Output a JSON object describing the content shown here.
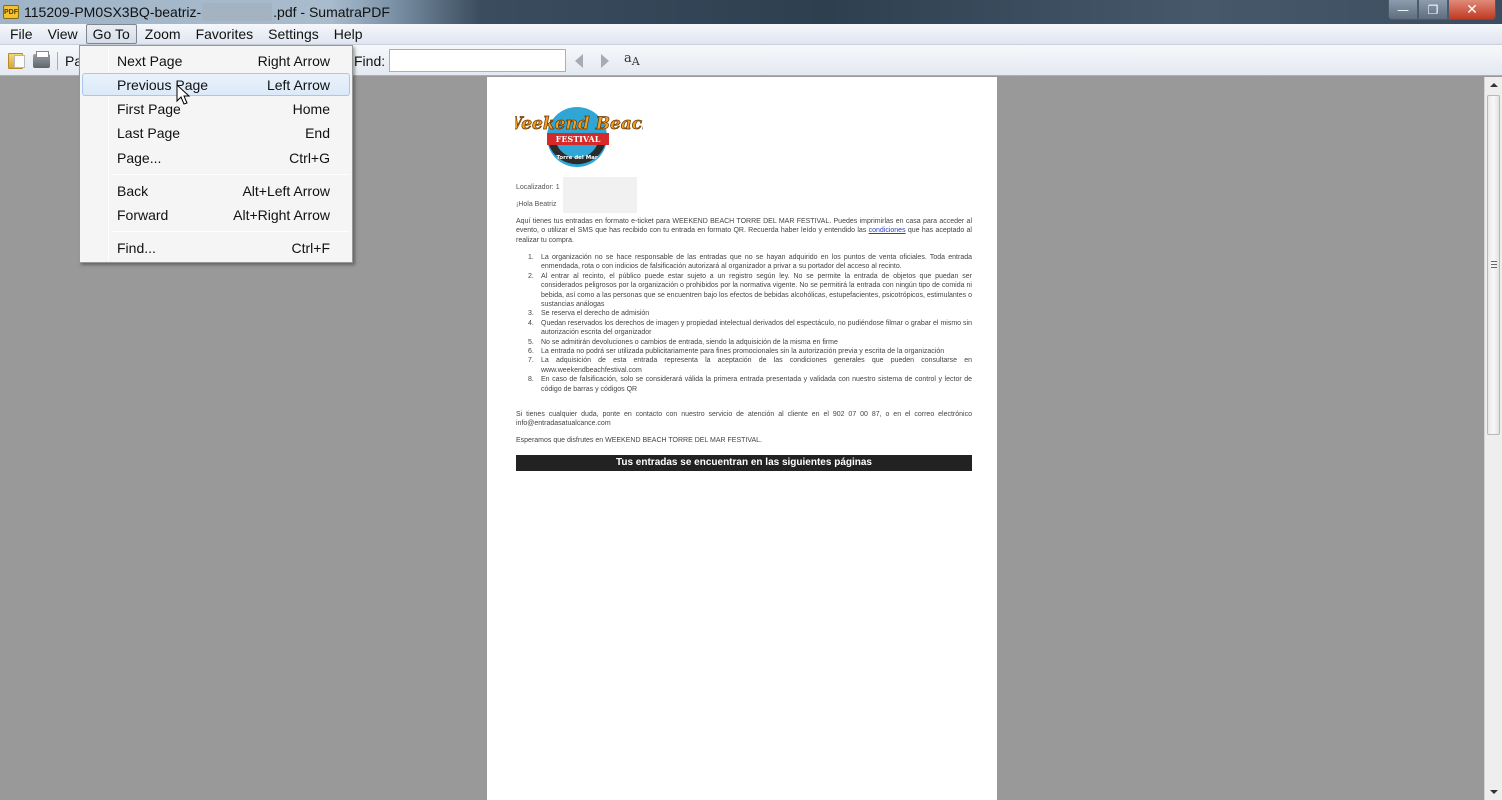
{
  "window": {
    "title_prefix": "115209-PM0SX3BQ-beatriz-",
    "title_suffix": ".pdf - SumatraPDF",
    "app_icon_label": "PDF",
    "controls": {
      "minimize": "—",
      "maximize": "❐",
      "close": "✕"
    }
  },
  "menubar": {
    "items": [
      "File",
      "View",
      "Go To",
      "Zoom",
      "Favorites",
      "Settings",
      "Help"
    ],
    "open_item": "Go To"
  },
  "toolbar": {
    "page_label_partial": "Pa",
    "find_label": "Find:",
    "find_value": "",
    "match_case_glyph_small": "a",
    "match_case_glyph_big": "A"
  },
  "goto_menu": {
    "items": [
      {
        "label": "Next Page",
        "shortcut": "Right Arrow"
      },
      {
        "label": "Previous Page",
        "shortcut": "Left Arrow",
        "hovered": true
      },
      {
        "label": "First Page",
        "shortcut": "Home"
      },
      {
        "label": "Last Page",
        "shortcut": "End"
      },
      {
        "label": "Page...",
        "shortcut": "Ctrl+G"
      },
      {
        "label": "Back",
        "shortcut": "Alt+Left Arrow"
      },
      {
        "label": "Forward",
        "shortcut": "Alt+Right Arrow"
      },
      {
        "label": "Find...",
        "shortcut": "Ctrl+F"
      }
    ]
  },
  "document": {
    "logo": {
      "line1": "Weekend Beach",
      "ribbon": "FESTIVAL",
      "arc": "Torre del Mar"
    },
    "localizador_label": "Localizador: 1",
    "greeting": "¡Hola Beatriz",
    "intro_pre": "Aquí tienes tus entradas en formato e-ticket para WEEKEND BEACH TORRE DEL MAR FESTIVAL. Puedes imprimirlas en casa para acceder al evento, o utilizar el SMS que has recibido con tu entrada en formato QR. Recuerda haber leído y entendido las ",
    "intro_link": "condiciones",
    "intro_post": " que has aceptado al realizar tu compra.",
    "conditions": [
      "La organización no se hace responsable de las entradas que no se hayan adquirido en los puntos de venta oficiales. Toda entrada enmendada, rota o con indicios de falsificación autorizará al organizador a privar a su portador del acceso al recinto.",
      "Al entrar al recinto, el público puede estar sujeto a un registro según ley. No se permite la entrada de objetos que puedan ser considerados peligrosos por la organización o prohibidos por la normativa vigente. No se permitirá la entrada con ningún tipo de comida ni bebida, así como a las personas que se encuentren bajo los efectos de bebidas alcohólicas, estupefacientes, psicotrópicos, estimulantes o sustancias análogas",
      "Se reserva el derecho de admisión",
      "Quedan reservados los derechos de imagen y propiedad intelectual derivados del espectáculo, no pudiéndose filmar o grabar el mismo sin autorización escrita del organizador",
      "No se admitirán devoluciones o cambios de entrada, siendo la adquisición de la misma en firme",
      "La entrada no podrá ser utilizada publicitariamente para fines promocionales sin la autorización previa y escrita de la organización",
      "La adquisición de esta entrada representa la aceptación de las condiciones generales que pueden consultarse en www.weekendbeachfestival.com",
      "En caso de falsificación, solo se considerará válida la primera entrada presentada y validada con nuestro sistema de control y lector de código de barras y códigos QR"
    ],
    "contact": "Si tienes cualquier duda, ponte en contacto con nuestro servicio de atención al cliente en el 902 07 00 87, o en el correo electrónico info@entradasatualcance.com",
    "closing": "Esperamos que disfrutes en WEEKEND BEACH TORRE DEL MAR FESTIVAL.",
    "banner": "Tus entradas se encuentran en las siguientes páginas"
  }
}
